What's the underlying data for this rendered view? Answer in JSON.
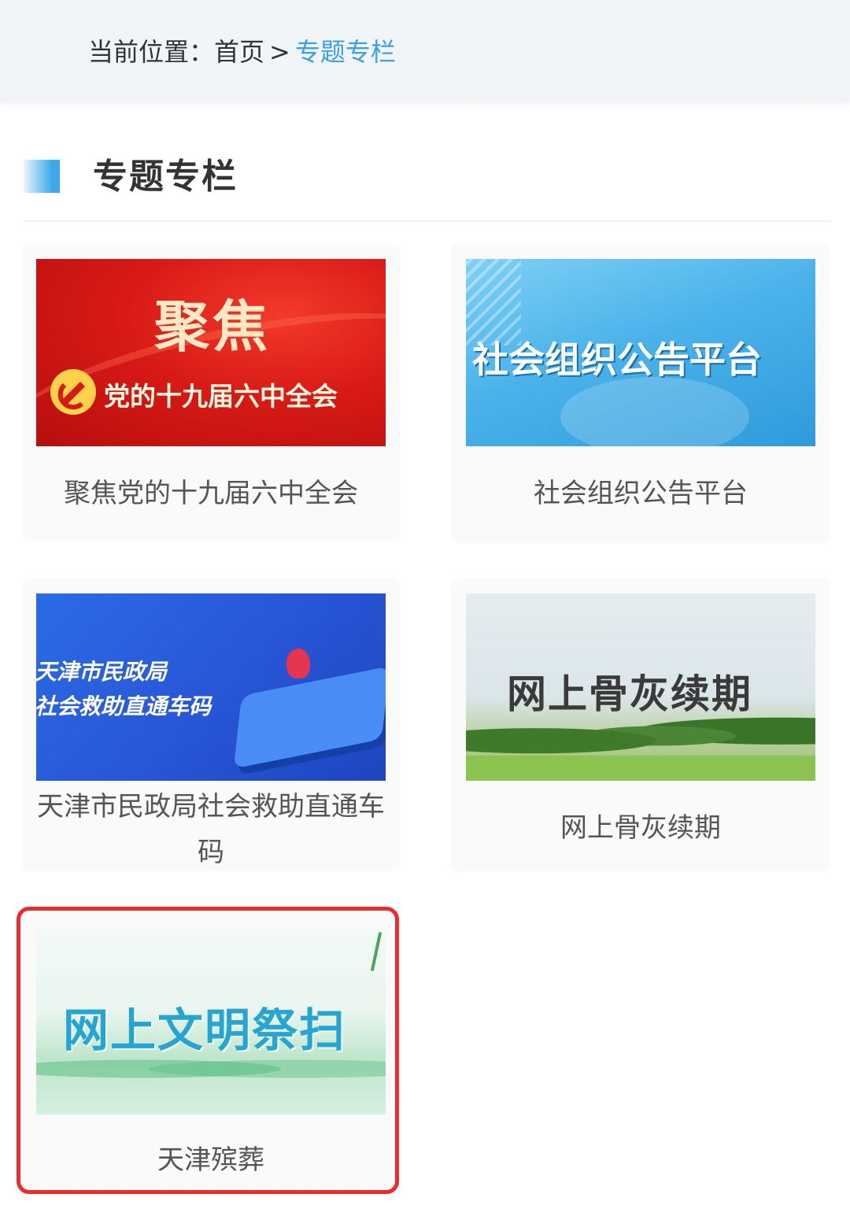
{
  "breadcrumb": {
    "prefix": "当前位置：",
    "home": "首页",
    "separator": ">",
    "current": "专题专栏"
  },
  "section": {
    "title": "专题专栏"
  },
  "cards": [
    {
      "banner_title": "聚焦",
      "banner_subtitle": "党的十九届六中全会",
      "caption": "聚焦党的十九届六中全会"
    },
    {
      "banner_title": "社会组织公告平台",
      "caption": "社会组织公告平台"
    },
    {
      "banner_line1": "天津市民政局",
      "banner_line2": "社会救助直通车码",
      "caption": "天津市民政局社会救助直通车码"
    },
    {
      "banner_title": "网上骨灰续期",
      "caption": "网上骨灰续期"
    },
    {
      "banner_title": "网上文明祭扫",
      "caption": "天津殡葬"
    }
  ],
  "colors": {
    "accent": "#3aa0e6",
    "highlight": "#ee2b2b"
  }
}
